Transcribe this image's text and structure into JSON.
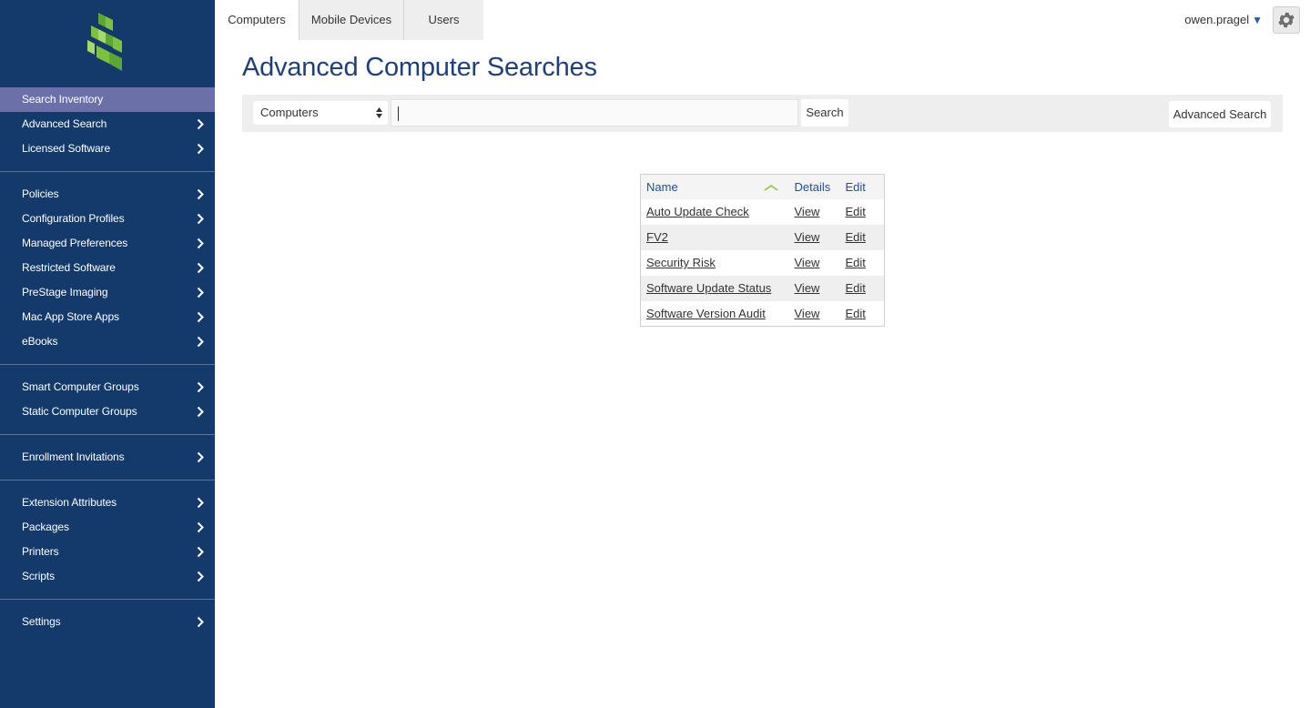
{
  "sidebar": {
    "groups": [
      [
        "Search Inventory",
        "Advanced Search",
        "Licensed Software"
      ],
      [
        "Policies",
        "Configuration Profiles",
        "Managed Preferences",
        "Restricted Software",
        "PreStage Imaging",
        "Mac App Store Apps",
        "eBooks"
      ],
      [
        "Smart Computer Groups",
        "Static Computer Groups"
      ],
      [
        "Enrollment Invitations"
      ],
      [
        "Extension Attributes",
        "Packages",
        "Printers",
        "Scripts"
      ],
      [
        "Settings"
      ]
    ],
    "active": "Search Inventory"
  },
  "tabs": [
    "Computers",
    "Mobile Devices",
    "Users"
  ],
  "active_tab": "Computers",
  "user": {
    "name": "owen.pragel"
  },
  "page": {
    "title": "Advanced Computer Searches"
  },
  "search": {
    "category": "Computers",
    "query": "",
    "search_label": "Search",
    "advanced_label": "Advanced Search"
  },
  "table": {
    "headers": {
      "name": "Name",
      "details": "Details",
      "edit": "Edit"
    },
    "rows": [
      {
        "name": "Auto Update Check",
        "details": "View",
        "edit": "Edit"
      },
      {
        "name": "FV2",
        "details": "View",
        "edit": "Edit"
      },
      {
        "name": "Security Risk",
        "details": "View",
        "edit": "Edit"
      },
      {
        "name": "Software Update Status",
        "details": "View",
        "edit": "Edit"
      },
      {
        "name": "Software Version Audit",
        "details": "View",
        "edit": "Edit"
      }
    ]
  },
  "colors": {
    "sidebar_bg": "#133a6a",
    "sidebar_active": "#6b70a8",
    "title": "#1f3f7a",
    "logo_green": "#7dc142",
    "sort_icon": "#8cc63f"
  },
  "icons": {
    "logo": "jamf-logo-icon",
    "chevron": "chevron-right-icon",
    "gear": "gear-icon",
    "caret": "caret-down-icon",
    "sort": "sort-ascending-icon",
    "select": "select-arrows-icon"
  }
}
